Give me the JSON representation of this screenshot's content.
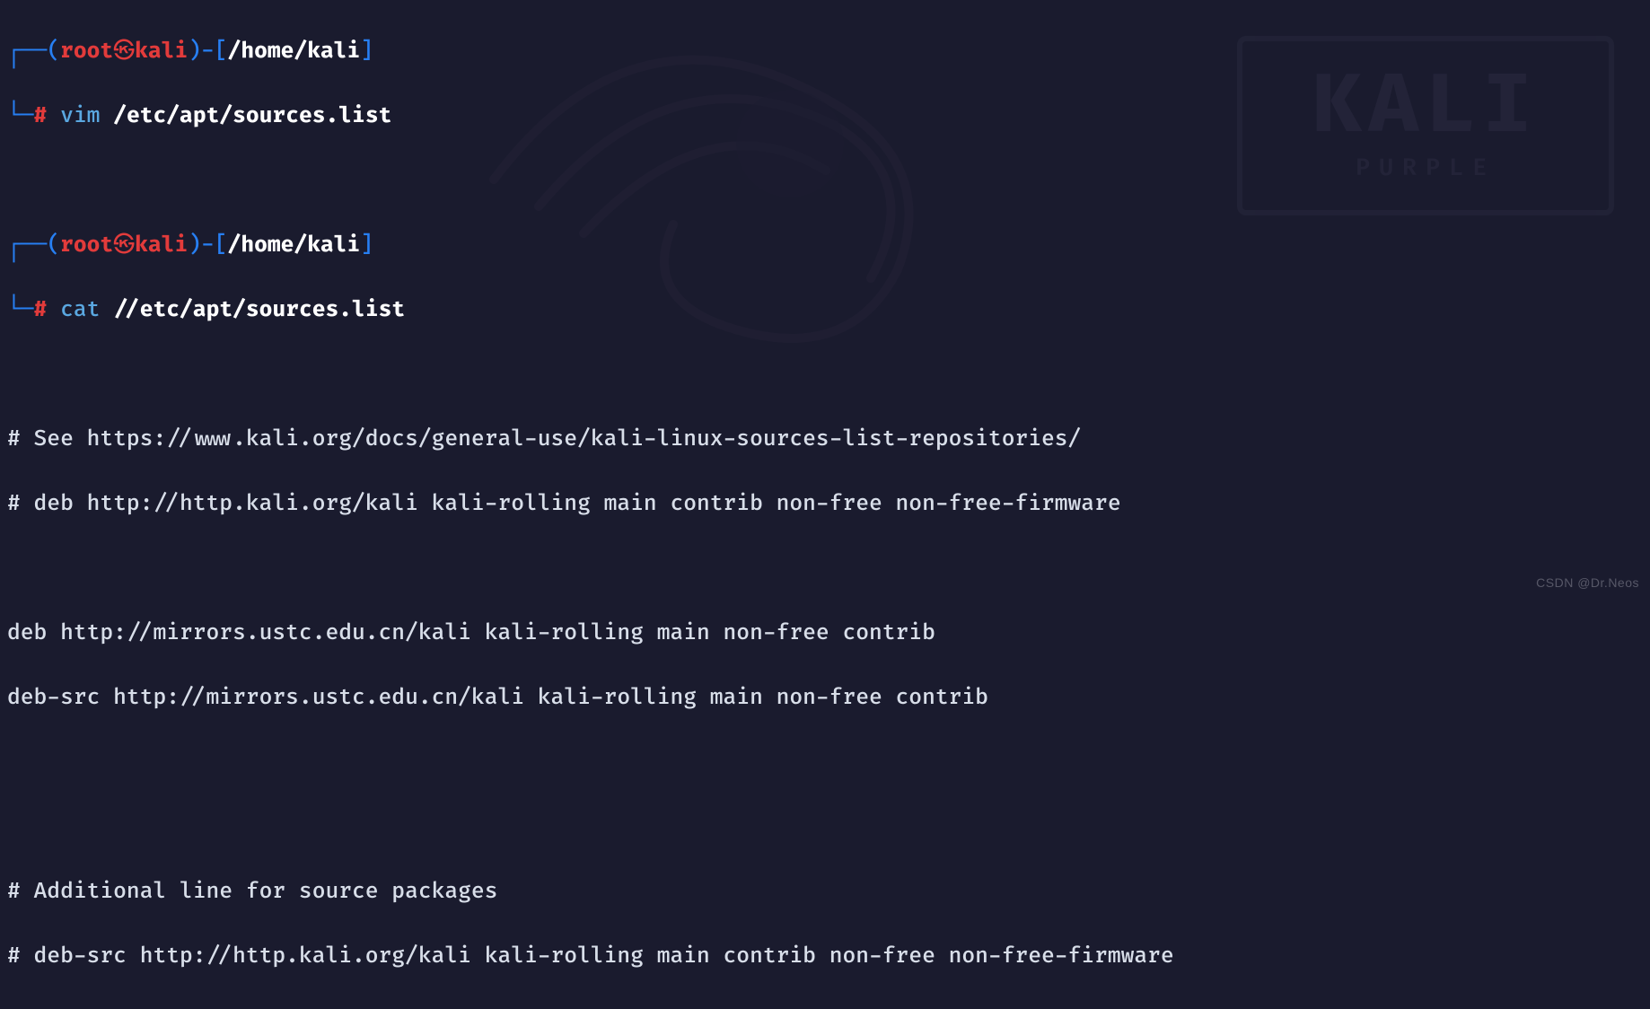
{
  "bg": {
    "logo_main": "KALI",
    "logo_sub": "PURPLE"
  },
  "prompts": [
    {
      "corner_tl": "┌──",
      "paren_l": "(",
      "user": "root",
      "skull": "㉿",
      "host": "kali",
      "paren_r": ")",
      "dash": "-",
      "bracket_l": "[",
      "cwd": "/home/kali",
      "bracket_r": "]",
      "corner_bl": "└─",
      "hash": "#",
      "cmd": "vim",
      "arg": "/etc/apt/sources.list"
    },
    {
      "corner_tl": "┌──",
      "paren_l": "(",
      "user": "root",
      "skull": "㉿",
      "host": "kali",
      "paren_r": ")",
      "dash": "-",
      "bracket_l": "[",
      "cwd": "/home/kali",
      "bracket_r": "]",
      "corner_bl": "└─",
      "hash": "#",
      "cmd": "cat",
      "arg": "//etc/apt/sources.list"
    }
  ],
  "output": [
    "# See https://www.kali.org/docs/general-use/kali-linux-sources-list-repositories/",
    "# deb http://http.kali.org/kali kali-rolling main contrib non-free non-free-firmware",
    "",
    "deb http://mirrors.ustc.edu.cn/kali kali-rolling main non-free contrib",
    "deb-src http://mirrors.ustc.edu.cn/kali kali-rolling main non-free contrib",
    "",
    "",
    "# Additional line for source packages",
    "# deb-src http://http.kali.org/kali kali-rolling main contrib non-free non-free-firmware"
  ],
  "watermark": "CSDN @Dr.Neos"
}
